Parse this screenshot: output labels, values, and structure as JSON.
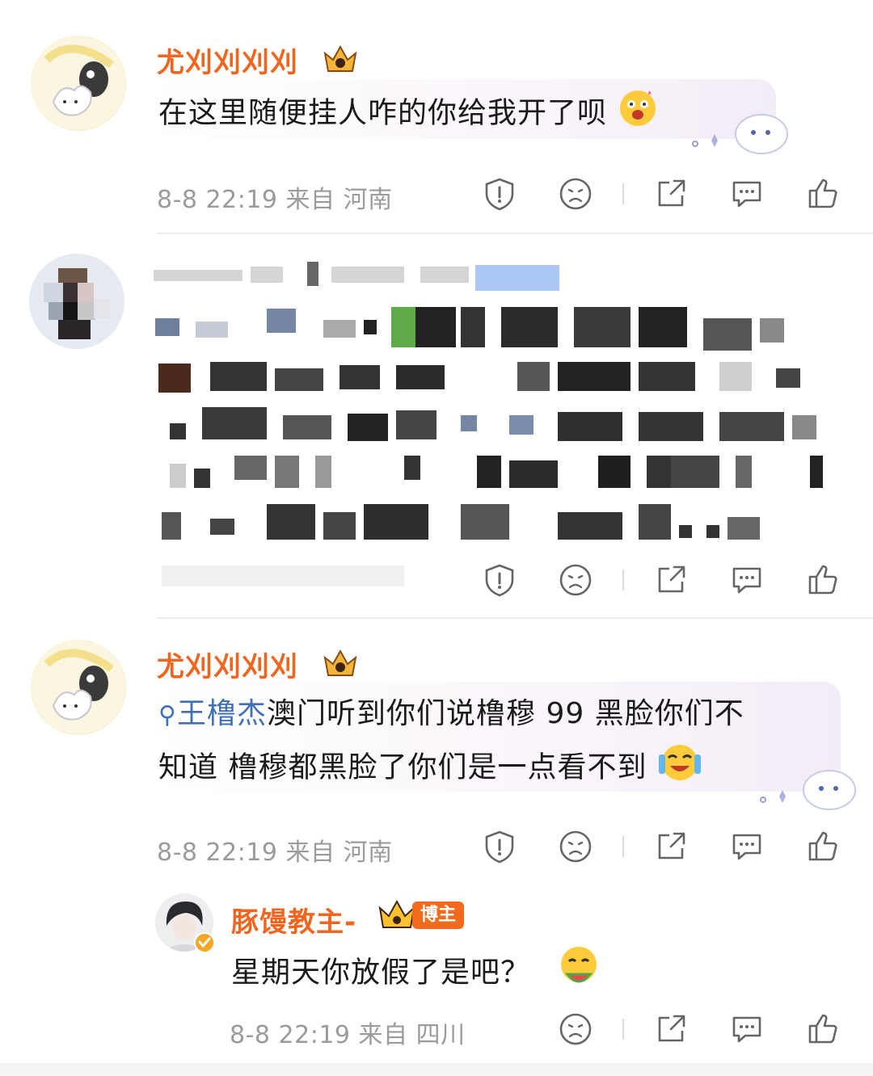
{
  "comments": [
    {
      "username": "尤刈刈刈刈",
      "text": "在这里随便挂人咋的你给我开了呗",
      "time": "8-8 22:19",
      "from_label": "来自",
      "location": "河南"
    },
    {
      "username": "",
      "text": "",
      "time": "",
      "from_label": "",
      "location": ""
    },
    {
      "username": "尤刈刈刈刈",
      "search_keyword": "王橹杰",
      "text_line1_rest": "澳门听到你们说橹穆 99 黑脸你们不",
      "text_line2": "知道  橹穆都黑脸了你们是一点看不到",
      "time": "8-8 22:19",
      "from_label": "来自",
      "location": "河南"
    }
  ],
  "reply": {
    "username": "豚馒教主-",
    "badge": "博主",
    "text": "星期天你放假了是吧？",
    "time": "8-8 22:19",
    "from_label": "来自",
    "location": "四川"
  },
  "colors": {
    "username": "#f1651f",
    "link": "#3f6fb6",
    "meta": "#9b9b9b"
  },
  "icons": [
    "report-icon",
    "dislike-face-icon",
    "share-icon",
    "comment-icon",
    "like-icon"
  ]
}
